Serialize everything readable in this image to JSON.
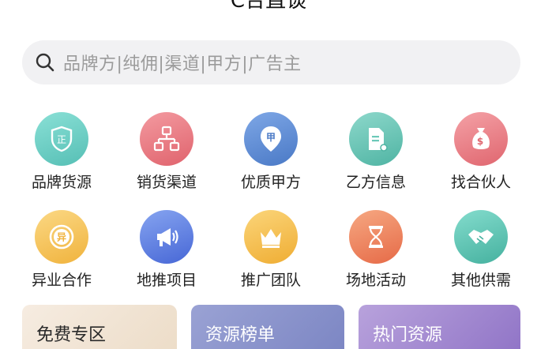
{
  "header": {
    "title": "C合直谈"
  },
  "search": {
    "placeholder": "品牌方|纯佣|渠道|甲方|广告主",
    "icon": "search-icon"
  },
  "categories": [
    {
      "label": "品牌货源",
      "icon": "shield-icon",
      "color": "#6fd1c8"
    },
    {
      "label": "销货渠道",
      "icon": "network-icon",
      "color": "#ee7f86"
    },
    {
      "label": "优质甲方",
      "icon": "location-pin-icon",
      "color": "#5b8fd6"
    },
    {
      "label": "乙方信息",
      "icon": "document-icon",
      "color": "#6cc9b9"
    },
    {
      "label": "找合伙人",
      "icon": "money-bag-icon",
      "color": "#ee8389"
    },
    {
      "label": "异业合作",
      "icon": "badge-icon",
      "color": "#f6c85a"
    },
    {
      "label": "地推项目",
      "icon": "megaphone-icon",
      "color": "#5e80e3"
    },
    {
      "label": "推广团队",
      "icon": "crown-icon",
      "color": "#f6c04d"
    },
    {
      "label": "场地活动",
      "icon": "hourglass-icon",
      "color": "#f08a65"
    },
    {
      "label": "其他供需",
      "icon": "handshake-icon",
      "color": "#5fc8b6"
    }
  ],
  "cards": [
    {
      "label": "免费专区"
    },
    {
      "label": "资源榜单"
    },
    {
      "label": "热门资源"
    }
  ]
}
